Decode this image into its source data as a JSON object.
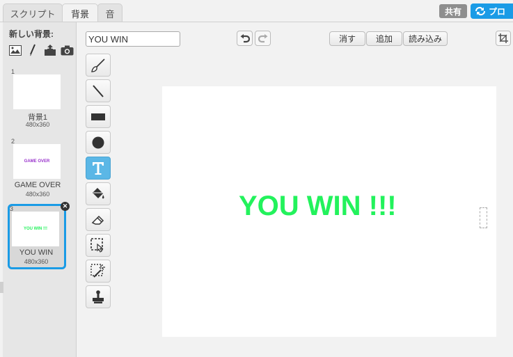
{
  "tabs": [
    {
      "label": "スクリプト"
    },
    {
      "label": "背景"
    },
    {
      "label": "音"
    }
  ],
  "header": {
    "share_label": "共有",
    "project_label": "プロ"
  },
  "left_panel": {
    "new_backdrop_label": "新しい背景:",
    "backdrops": [
      {
        "number": "1",
        "name": "背景1",
        "size": "480x360",
        "thumb_text": "",
        "thumb_color": "#ffffff"
      },
      {
        "number": "2",
        "name": "GAME OVER",
        "size": "480x360",
        "thumb_text": "GAME OVER",
        "thumb_color": "#9933cc"
      },
      {
        "number": "3",
        "name": "YOU WIN",
        "size": "480x360",
        "thumb_text": "YOU WIN !!!",
        "thumb_color": "#23f25c"
      }
    ],
    "selected_index": 2
  },
  "editor": {
    "name_value": "YOU WIN",
    "clear_label": "消す",
    "add_label": "追加",
    "import_label": "読み込み",
    "active_tool": "text-tool",
    "canvas_text": "YOU WIN !!!",
    "canvas_text_color": "#23f25c"
  },
  "colors": {
    "accent": "#1a9be6",
    "active_tool": "#5bb7e6"
  }
}
